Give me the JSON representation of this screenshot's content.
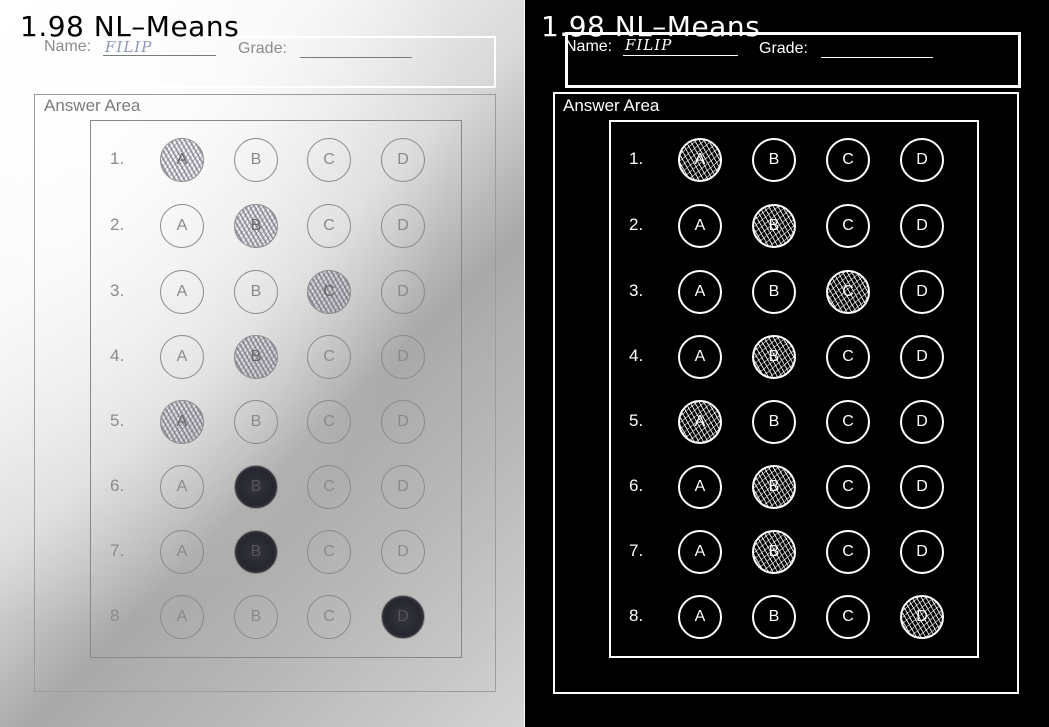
{
  "panels": {
    "left": {
      "method_label": "1.98 NL–Means",
      "name_label": "Name:",
      "name_value": "FILIP",
      "grade_label": "Grade:",
      "answer_area_label": "Answer Area"
    },
    "right": {
      "method_label": "1.98 NL–Means",
      "name_label": "Name:",
      "name_value": "FILIP",
      "grade_label": "Grade:",
      "answer_area_label": "Answer Area"
    }
  },
  "questions": [
    {
      "number": "1.",
      "options": [
        "A",
        "B",
        "C",
        "D"
      ],
      "marked": "A"
    },
    {
      "number": "2.",
      "options": [
        "A",
        "B",
        "C",
        "D"
      ],
      "marked": "B"
    },
    {
      "number": "3.",
      "options": [
        "A",
        "B",
        "C",
        "D"
      ],
      "marked": "C"
    },
    {
      "number": "4.",
      "options": [
        "A",
        "B",
        "C",
        "D"
      ],
      "marked": "B"
    },
    {
      "number": "5.",
      "options": [
        "A",
        "B",
        "C",
        "D"
      ],
      "marked": "A"
    },
    {
      "number": "6.",
      "options": [
        "A",
        "B",
        "C",
        "D"
      ],
      "marked": "B"
    },
    {
      "number": "7.",
      "options": [
        "A",
        "B",
        "C",
        "D"
      ],
      "marked": "B"
    },
    {
      "number": "8",
      "options": [
        "A",
        "B",
        "C",
        "D"
      ],
      "marked": "D"
    }
  ],
  "right_question_numbers": [
    "1.",
    "2.",
    "3.",
    "4.",
    "5.",
    "6.",
    "7.",
    "8."
  ],
  "dark_fill_rows_left": [
    6,
    7,
    8
  ]
}
